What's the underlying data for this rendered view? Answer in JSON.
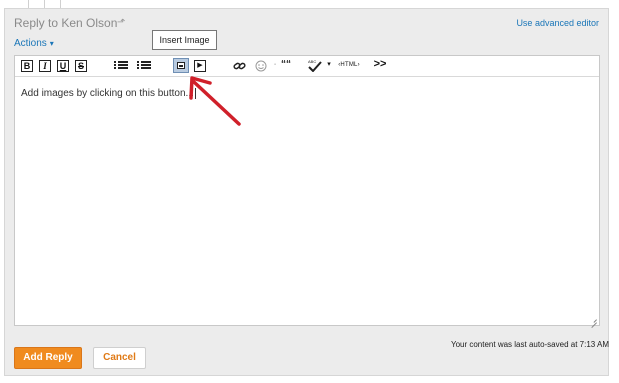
{
  "window": {
    "title": "Reply to Ken Olson",
    "advanced_editor_link": "Use advanced editor",
    "actions_menu": "Actions"
  },
  "toolbar": {
    "bold": "B",
    "italic": "I",
    "underline": "U",
    "strikethrough": "S",
    "quote": "““",
    "html": "‹HTML›",
    "more": ">>",
    "tooltip": "Insert Image"
  },
  "editor": {
    "content": "Add images by clicking on this button..."
  },
  "footer": {
    "autosave_status": "Your content was last auto-saved at 7:13 AM",
    "add_reply_label": "Add Reply",
    "cancel_label": "Cancel"
  },
  "colors": {
    "accent_link": "#1a76b8",
    "primary_button": "#f08b1f",
    "annotation_arrow": "#d0202a"
  },
  "icons": [
    "pin-icon",
    "bulleted-list-icon",
    "numbered-list-icon",
    "insert-image-icon",
    "insert-video-icon",
    "link-icon",
    "emoji-icon",
    "spellcheck-icon",
    "resize-handle-icon"
  ]
}
